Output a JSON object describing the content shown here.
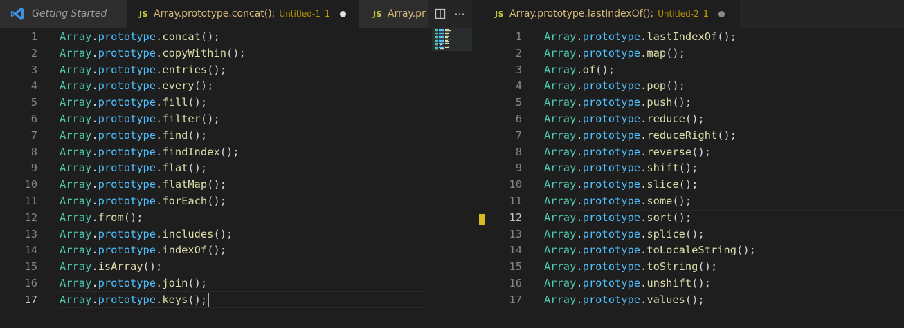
{
  "left_group": {
    "tabs": [
      {
        "kind": "welcome",
        "title": "Getting Started",
        "active": false
      },
      {
        "kind": "file",
        "badge": "JS",
        "title": "Array.prototype.concat();",
        "desc": "Untitled-1",
        "count": "1",
        "dirty": true,
        "active": true
      },
      {
        "kind": "file",
        "badge": "JS",
        "title": "Array.pr",
        "active": false
      }
    ],
    "actions": {
      "split_icon": "split-editor-icon",
      "more_icon": "more-actions-icon",
      "more_label": "···"
    },
    "cursor_line": 17,
    "lines": [
      {
        "n": "1",
        "code": [
          "Array",
          ".",
          "prototype",
          ".",
          "concat",
          "();"
        ]
      },
      {
        "n": "2",
        "code": [
          "Array",
          ".",
          "prototype",
          ".",
          "copyWithin",
          "();"
        ]
      },
      {
        "n": "3",
        "code": [
          "Array",
          ".",
          "prototype",
          ".",
          "entries",
          "();"
        ]
      },
      {
        "n": "4",
        "code": [
          "Array",
          ".",
          "prototype",
          ".",
          "every",
          "();"
        ]
      },
      {
        "n": "5",
        "code": [
          "Array",
          ".",
          "prototype",
          ".",
          "fill",
          "();"
        ]
      },
      {
        "n": "6",
        "code": [
          "Array",
          ".",
          "prototype",
          ".",
          "filter",
          "();"
        ]
      },
      {
        "n": "7",
        "code": [
          "Array",
          ".",
          "prototype",
          ".",
          "find",
          "();"
        ]
      },
      {
        "n": "8",
        "code": [
          "Array",
          ".",
          "prototype",
          ".",
          "findIndex",
          "();"
        ]
      },
      {
        "n": "9",
        "code": [
          "Array",
          ".",
          "prototype",
          ".",
          "flat",
          "();"
        ]
      },
      {
        "n": "10",
        "code": [
          "Array",
          ".",
          "prototype",
          ".",
          "flatMap",
          "();"
        ]
      },
      {
        "n": "11",
        "code": [
          "Array",
          ".",
          "prototype",
          ".",
          "forEach",
          "();"
        ]
      },
      {
        "n": "12",
        "code": [
          "Array",
          ".",
          "",
          "",
          "from",
          "();"
        ]
      },
      {
        "n": "13",
        "code": [
          "Array",
          ".",
          "prototype",
          ".",
          "includes",
          "();"
        ]
      },
      {
        "n": "14",
        "code": [
          "Array",
          ".",
          "prototype",
          ".",
          "indexOf",
          "();"
        ]
      },
      {
        "n": "15",
        "code": [
          "Array",
          ".",
          "",
          "",
          "isArray",
          "();"
        ]
      },
      {
        "n": "16",
        "code": [
          "Array",
          ".",
          "prototype",
          ".",
          "join",
          "();"
        ]
      },
      {
        "n": "17",
        "code": [
          "Array",
          ".",
          "prototype",
          ".",
          "keys",
          "();"
        ]
      }
    ]
  },
  "right_group": {
    "tabs": [
      {
        "kind": "file",
        "badge": "JS",
        "title": "Array.prototype.lastIndexOf();",
        "desc": "Untitled-2",
        "count": "1",
        "dirty": true,
        "active": true
      }
    ],
    "cursor_line": 12,
    "lines": [
      {
        "n": "1",
        "code": [
          "Array",
          ".",
          "prototype",
          ".",
          "lastIndexOf",
          "();"
        ]
      },
      {
        "n": "2",
        "code": [
          "Array",
          ".",
          "prototype",
          ".",
          "map",
          "();"
        ]
      },
      {
        "n": "3",
        "code": [
          "Array",
          ".",
          "",
          "",
          "of",
          "();"
        ]
      },
      {
        "n": "4",
        "code": [
          "Array",
          ".",
          "prototype",
          ".",
          "pop",
          "();"
        ]
      },
      {
        "n": "5",
        "code": [
          "Array",
          ".",
          "prototype",
          ".",
          "push",
          "();"
        ]
      },
      {
        "n": "6",
        "code": [
          "Array",
          ".",
          "prototype",
          ".",
          "reduce",
          "();"
        ]
      },
      {
        "n": "7",
        "code": [
          "Array",
          ".",
          "prototype",
          ".",
          "reduceRight",
          "();"
        ]
      },
      {
        "n": "8",
        "code": [
          "Array",
          ".",
          "prototype",
          ".",
          "reverse",
          "();"
        ]
      },
      {
        "n": "9",
        "code": [
          "Array",
          ".",
          "prototype",
          ".",
          "shift",
          "();"
        ]
      },
      {
        "n": "10",
        "code": [
          "Array",
          ".",
          "prototype",
          ".",
          "slice",
          "();"
        ]
      },
      {
        "n": "11",
        "code": [
          "Array",
          ".",
          "prototype",
          ".",
          "some",
          "();"
        ]
      },
      {
        "n": "12",
        "code": [
          "Array",
          ".",
          "prototype",
          ".",
          "sort",
          "();"
        ]
      },
      {
        "n": "13",
        "code": [
          "Array",
          ".",
          "prototype",
          ".",
          "splice",
          "();"
        ]
      },
      {
        "n": "14",
        "code": [
          "Array",
          ".",
          "prototype",
          ".",
          "toLocaleString",
          "();"
        ]
      },
      {
        "n": "15",
        "code": [
          "Array",
          ".",
          "prototype",
          ".",
          "toString",
          "();"
        ]
      },
      {
        "n": "16",
        "code": [
          "Array",
          ".",
          "prototype",
          ".",
          "unshift",
          "();"
        ]
      },
      {
        "n": "17",
        "code": [
          "Array",
          ".",
          "prototype",
          ".",
          "values",
          "();"
        ]
      }
    ]
  },
  "colors": {
    "background": "#1e1e1e",
    "class": "#4ec9b0",
    "property": "#4fc1ff",
    "function": "#dcdcaa",
    "punctuation": "#d4d4d4",
    "line_number": "#858585",
    "tab_title_warning": "#d7ba7d",
    "js_badge": "#cbcb41"
  }
}
